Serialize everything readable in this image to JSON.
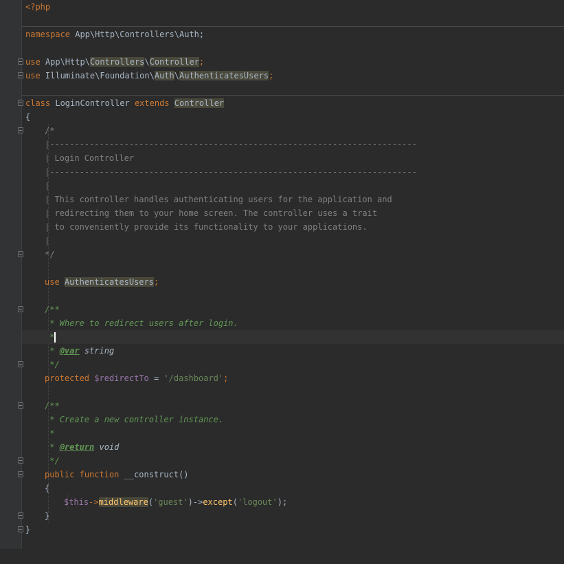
{
  "editor": {
    "lines": {
      "l1": {
        "tag": "<?php"
      },
      "l3": {
        "kw": "namespace",
        "name": " App\\Http\\Controllers\\Auth;"
      },
      "l5": {
        "kw": "use",
        "p1": " App\\Http\\",
        "h1": "Controllers",
        "bs": "\\",
        "h2": "Controller",
        "end": ";"
      },
      "l6": {
        "kw": "use",
        "p1": " Illuminate\\Foundation\\",
        "h1": "Auth",
        "bs": "\\",
        "h2": "AuthenticatesUsers",
        "end": ";"
      },
      "l8": {
        "kw1": "class",
        "name": " LoginController ",
        "kw2": "extends",
        "sp": " ",
        "parent": "Controller"
      },
      "l9": {
        "text": "{"
      },
      "l10": {
        "text": "/*"
      },
      "l11": {
        "text": "|--------------------------------------------------------------------------"
      },
      "l12": {
        "text": "| Login Controller"
      },
      "l13": {
        "text": "|--------------------------------------------------------------------------"
      },
      "l14": {
        "text": "|"
      },
      "l15": {
        "text": "| This controller handles authenticating users for the application and"
      },
      "l16": {
        "text": "| redirecting them to your home screen. The controller uses a trait"
      },
      "l17": {
        "text": "| to conveniently provide its functionality to your applications."
      },
      "l18": {
        "text": "|"
      },
      "l19": {
        "text": "*/"
      },
      "l21": {
        "kw": "use",
        "sp": " ",
        "trait": "AuthenticatesUsers",
        "end": ";"
      },
      "l23": {
        "text": "/**"
      },
      "l24": {
        "text": " * Where to redirect users after login."
      },
      "l25": {
        "text": " *"
      },
      "l26": {
        "star": " * ",
        "tag": "@var",
        "type": " string"
      },
      "l27": {
        "text": " */"
      },
      "l28": {
        "kw": "protected",
        "sp": " ",
        "var": "$redirectTo",
        "eq": " = ",
        "str": "'/dashboard'",
        "end": ";"
      },
      "l30": {
        "text": "/**"
      },
      "l31": {
        "text": " * Create a new controller instance."
      },
      "l32": {
        "text": " *"
      },
      "l33": {
        "star": " * ",
        "tag": "@return",
        "type": " void"
      },
      "l34": {
        "text": " */"
      },
      "l35": {
        "kw1": "public",
        "sp": " ",
        "kw2": "function",
        "name": " __construct()"
      },
      "l36": {
        "text": "{"
      },
      "l37": {
        "var": "$this",
        "arrow1": "->",
        "m1": "middleware",
        "op1": "(",
        "s1": "'guest'",
        "close1": ")->",
        "m2": "except",
        "op2": "(",
        "s2": "'logout'",
        "close2": ");"
      },
      "l38": {
        "text": "}"
      },
      "l39": {
        "text": "}"
      }
    },
    "colors": {
      "background": "#2b2b2b",
      "keyword": "#cc7832",
      "string": "#6a8759",
      "comment": "#808080",
      "doc_comment": "#629755",
      "variable": "#9876aa",
      "function": "#ffc66d",
      "default": "#a9b7c6",
      "highlight": "#49483b"
    }
  }
}
